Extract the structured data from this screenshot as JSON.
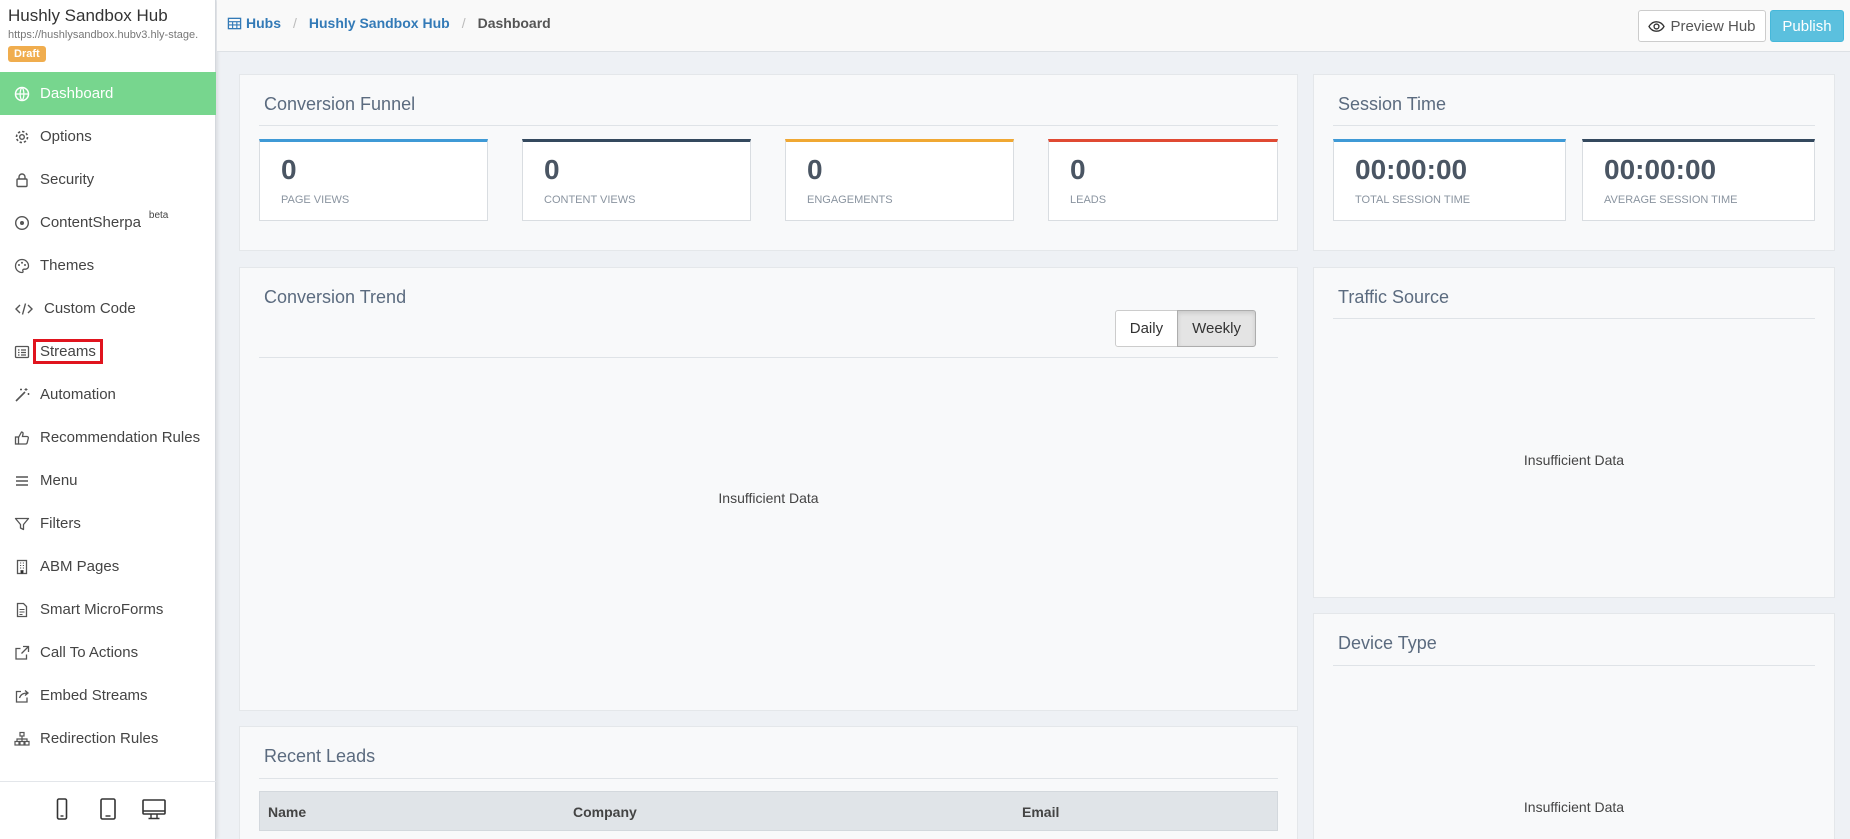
{
  "sidebar": {
    "hub_title": "Hushly Sandbox Hub",
    "hub_url": "https://hushlysandbox.hubv3.hly-stage.",
    "status_badge": "Draft",
    "items": [
      {
        "label": "Dashboard",
        "icon": "globe-icon"
      },
      {
        "label": "Options",
        "icon": "gear-icon"
      },
      {
        "label": "Security",
        "icon": "lock-icon"
      },
      {
        "label": "ContentSherpa",
        "icon": "compass-icon",
        "badge": "beta"
      },
      {
        "label": "Themes",
        "icon": "palette-icon"
      },
      {
        "label": "Custom Code",
        "icon": "code-icon"
      },
      {
        "label": "Streams",
        "icon": "list-icon"
      },
      {
        "label": "Automation",
        "icon": "magic-wand-icon"
      },
      {
        "label": "Recommendation Rules",
        "icon": "thumbs-up-icon"
      },
      {
        "label": "Menu",
        "icon": "hamburger-icon"
      },
      {
        "label": "Filters",
        "icon": "filter-icon"
      },
      {
        "label": "ABM Pages",
        "icon": "building-icon"
      },
      {
        "label": "Smart MicroForms",
        "icon": "document-icon"
      },
      {
        "label": "Call To Actions",
        "icon": "external-link-icon"
      },
      {
        "label": "Embed Streams",
        "icon": "share-icon"
      },
      {
        "label": "Redirection Rules",
        "icon": "sitemap-icon"
      }
    ],
    "devices": [
      "mobile-icon",
      "tablet-icon",
      "desktop-icon"
    ]
  },
  "breadcrumb": {
    "hubs": "Hubs",
    "hub": "Hushly Sandbox Hub",
    "current": "Dashboard"
  },
  "header": {
    "preview_label": "Preview Hub",
    "publish_label": "Publish"
  },
  "funnel": {
    "title": "Conversion Funnel",
    "stats": [
      {
        "value": "0",
        "label": "PAGE VIEWS",
        "color": "#3f9ad6"
      },
      {
        "value": "0",
        "label": "CONTENT VIEWS",
        "color": "#34495e"
      },
      {
        "value": "0",
        "label": "ENGAGEMENTS",
        "color": "#f0a833"
      },
      {
        "value": "0",
        "label": "LEADS",
        "color": "#e04a33"
      }
    ]
  },
  "session": {
    "title": "Session Time",
    "stats": [
      {
        "value": "00:00:00",
        "label": "TOTAL SESSION TIME",
        "color": "#3f9ad6"
      },
      {
        "value": "00:00:00",
        "label": "AVERAGE SESSION TIME",
        "color": "#34495e"
      }
    ]
  },
  "trend": {
    "title": "Conversion Trend",
    "daily_label": "Daily",
    "weekly_label": "Weekly",
    "empty_text": "Insufficient Data"
  },
  "traffic": {
    "title": "Traffic Source",
    "empty_text": "Insufficient Data"
  },
  "device": {
    "title": "Device Type",
    "empty_text": "Insufficient Data"
  },
  "leads": {
    "title": "Recent Leads",
    "columns": [
      "Name",
      "Company",
      "Email"
    ]
  }
}
